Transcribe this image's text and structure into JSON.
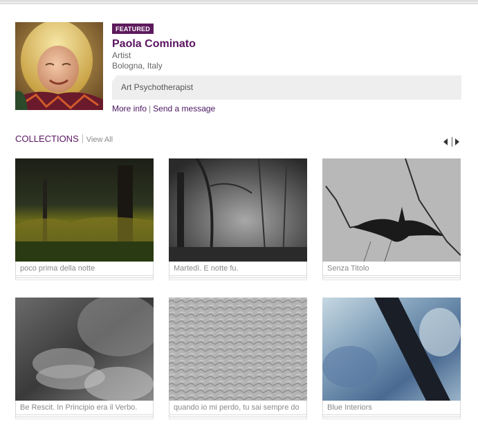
{
  "profile": {
    "badge": "FEATURED",
    "name": "Paola Cominato",
    "role": "Artist",
    "location": "Bologna, Italy",
    "bio": "Art Psychotherapist",
    "more_info": "More info",
    "separator": "|",
    "send_message": "Send a message"
  },
  "collections": {
    "title": "COLLECTIONS",
    "view_all": "View All",
    "items": [
      {
        "caption": "poco prima della notte"
      },
      {
        "caption": "Martedì. E notte fu."
      },
      {
        "caption": "Senza Titolo"
      },
      {
        "caption": "Be Rescit. In Principio era il Verbo."
      },
      {
        "caption": "quando io mi perdo, tu sai sempre do"
      },
      {
        "caption": "Blue Interiors"
      }
    ]
  },
  "colors": {
    "accent": "#5a1460",
    "badge_bg": "#5c1a5c",
    "bio_bg": "#eeeeee"
  }
}
